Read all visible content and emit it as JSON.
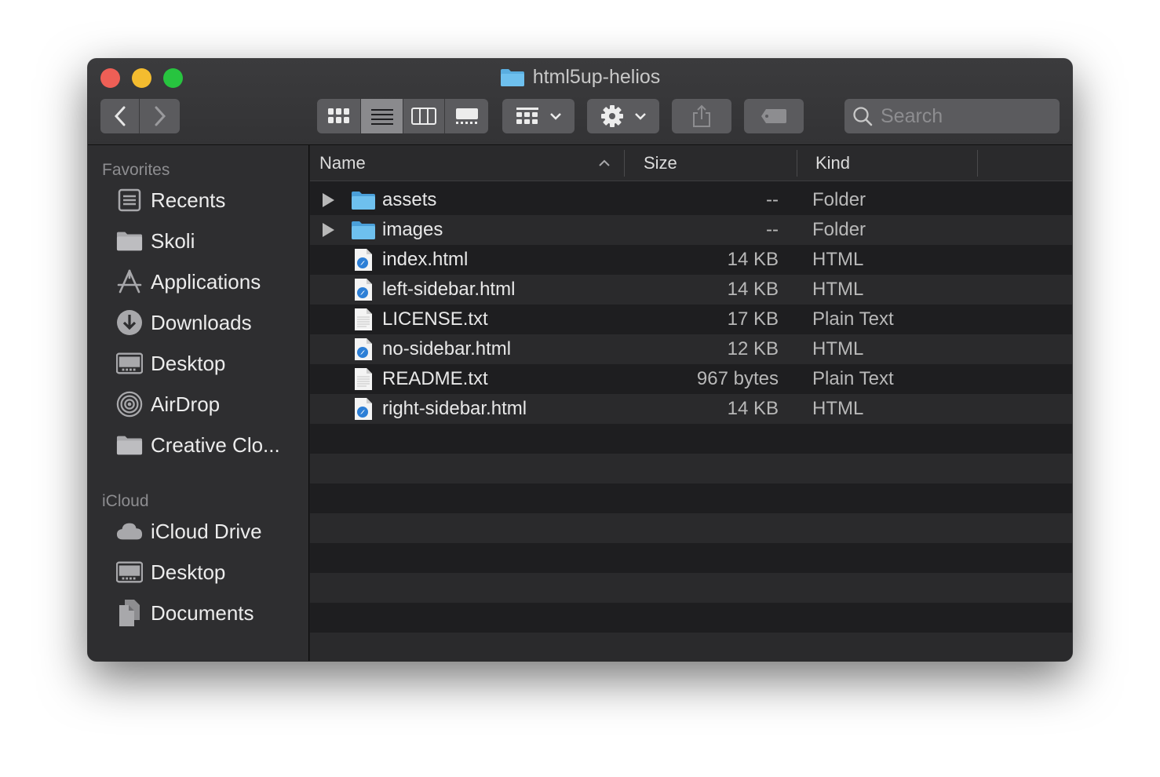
{
  "window": {
    "title": "html5up-helios",
    "search_placeholder": "Search"
  },
  "toolbar": {
    "view_modes": [
      "icon-view",
      "list-view",
      "column-view",
      "gallery-view"
    ],
    "active_view": "list-view"
  },
  "sidebar": {
    "favorites_label": "Favorites",
    "favorites": [
      {
        "label": "Recents",
        "icon": "recents-icon"
      },
      {
        "label": "Skoli",
        "icon": "folder-icon"
      },
      {
        "label": "Applications",
        "icon": "applications-icon"
      },
      {
        "label": "Downloads",
        "icon": "downloads-icon"
      },
      {
        "label": "Desktop",
        "icon": "desktop-icon"
      },
      {
        "label": "AirDrop",
        "icon": "airdrop-icon"
      },
      {
        "label": "Creative Clo...",
        "icon": "folder-icon"
      }
    ],
    "icloud_label": "iCloud",
    "icloud": [
      {
        "label": "iCloud Drive",
        "icon": "cloud-icon"
      },
      {
        "label": "Desktop",
        "icon": "desktop-icon"
      },
      {
        "label": "Documents",
        "icon": "documents-icon"
      }
    ]
  },
  "columns": {
    "name": "Name",
    "size": "Size",
    "kind": "Kind"
  },
  "files": [
    {
      "name": "assets",
      "size": "--",
      "kind": "Folder",
      "type": "folder"
    },
    {
      "name": "images",
      "size": "--",
      "kind": "Folder",
      "type": "folder"
    },
    {
      "name": "index.html",
      "size": "14 KB",
      "kind": "HTML",
      "type": "html"
    },
    {
      "name": "left-sidebar.html",
      "size": "14 KB",
      "kind": "HTML",
      "type": "html"
    },
    {
      "name": "LICENSE.txt",
      "size": "17 KB",
      "kind": "Plain Text",
      "type": "text"
    },
    {
      "name": "no-sidebar.html",
      "size": "12 KB",
      "kind": "HTML",
      "type": "html"
    },
    {
      "name": "README.txt",
      "size": "967 bytes",
      "kind": "Plain Text",
      "type": "text"
    },
    {
      "name": "right-sidebar.html",
      "size": "14 KB",
      "kind": "HTML",
      "type": "html"
    }
  ],
  "colors": {
    "folder_blue": "#5aaee0",
    "close": "#ee5f56",
    "minimize": "#f4bc2f",
    "maximize": "#27c43f"
  }
}
